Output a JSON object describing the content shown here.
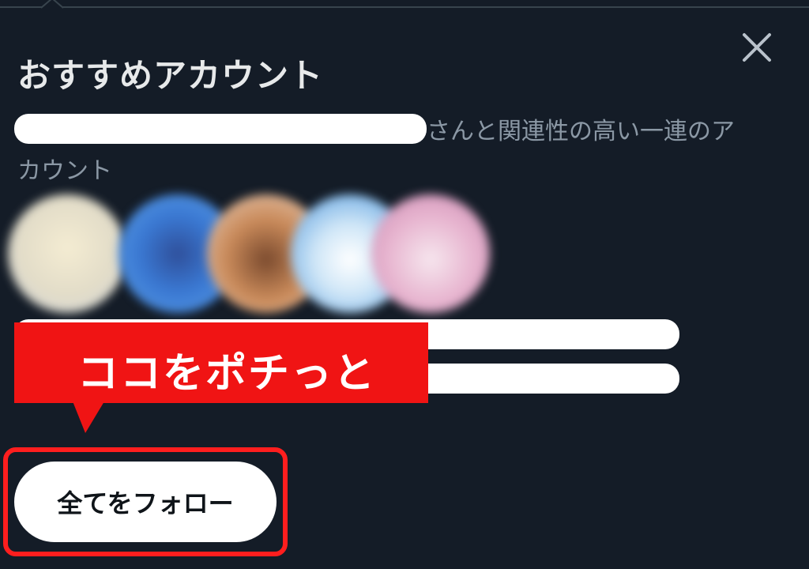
{
  "modal": {
    "title": "おすすめアカウント",
    "description_line1_visible": "さんと関連性の高い一連のア",
    "description_line2": "カウント",
    "follow_all_label": "全てをフォロー",
    "close_icon": "close-icon"
  },
  "annotation": {
    "callout_text": "ココをポチっと",
    "callout_color": "#f01414",
    "frame_color": "#ff1e1e"
  },
  "avatars": [
    {
      "name": "avatar-1",
      "color": "#e9e4d6"
    },
    {
      "name": "avatar-2",
      "color": "#3c7bd0"
    },
    {
      "name": "avatar-3",
      "color": "#c7895c"
    },
    {
      "name": "avatar-4",
      "color": "#5a9ee0"
    },
    {
      "name": "avatar-5",
      "color": "#e8b9d6"
    }
  ],
  "colors": {
    "background": "#141c27",
    "text_primary": "#e7e9ea",
    "text_secondary": "#8b98a5"
  }
}
